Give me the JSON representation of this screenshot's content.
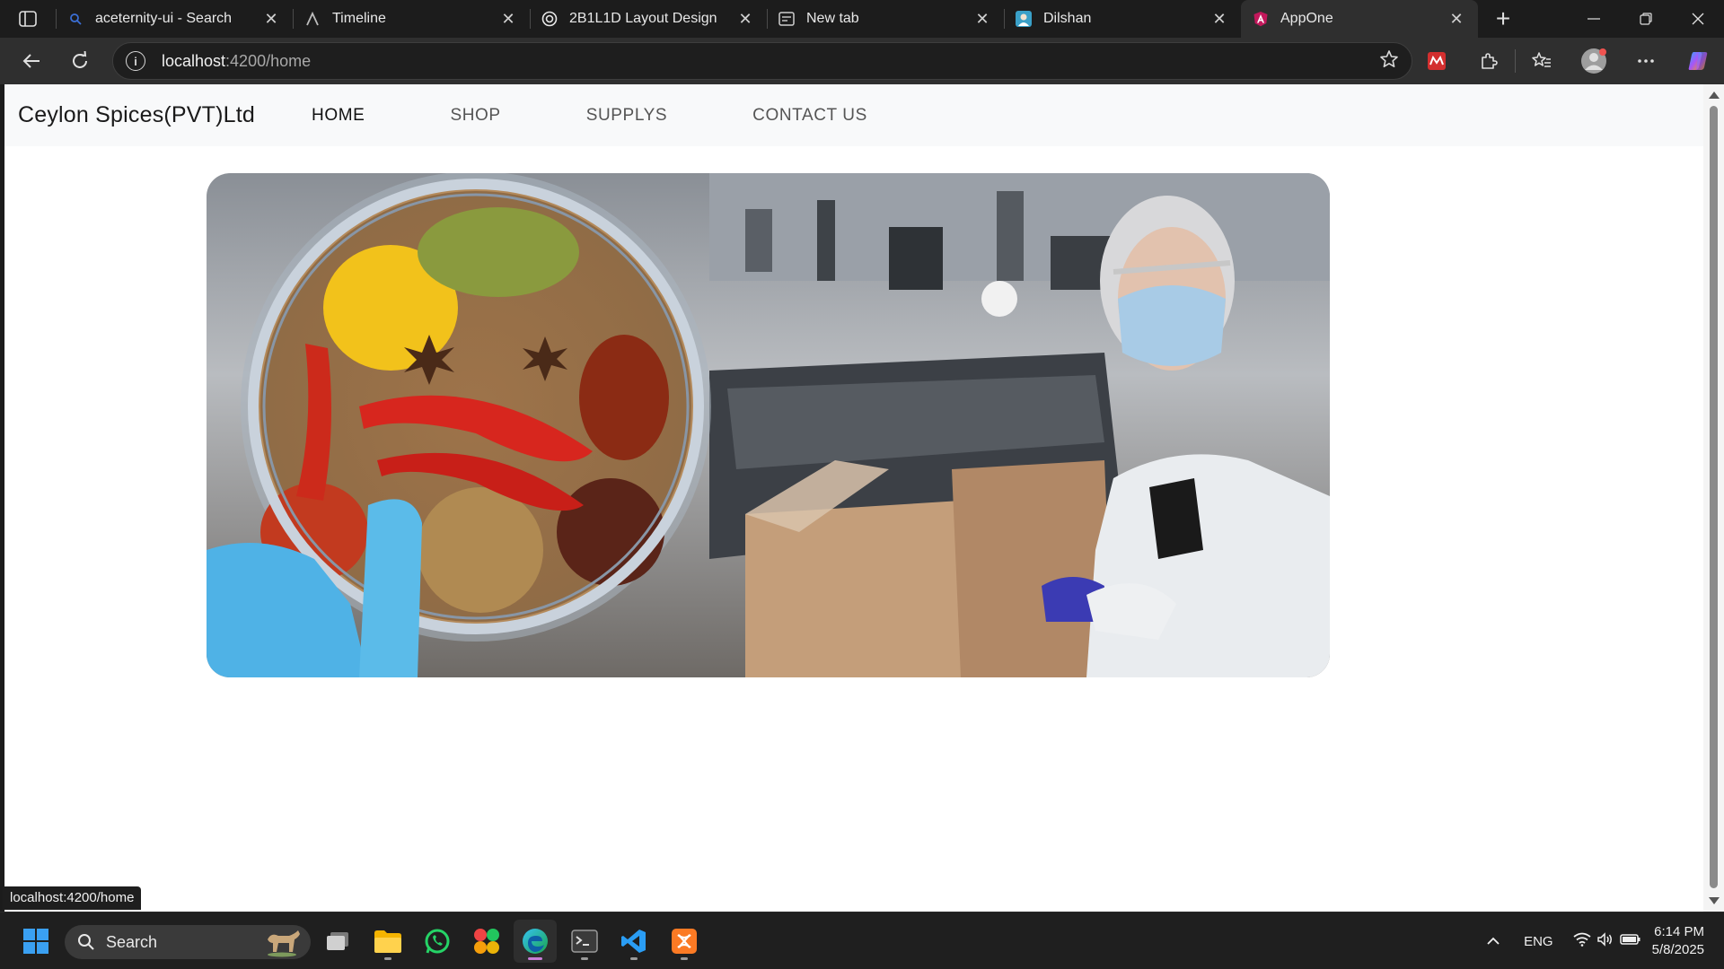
{
  "tabs": [
    {
      "title": "aceternity-ui - Search",
      "icon": "search-favicon",
      "active": false
    },
    {
      "title": "Timeline",
      "icon": "a-logo-favicon",
      "active": false
    },
    {
      "title": "2B1L1D Layout Design",
      "icon": "openai-favicon",
      "active": false
    },
    {
      "title": "New tab",
      "icon": "newtab-favicon",
      "active": false
    },
    {
      "title": "Dilshan",
      "icon": "profile-favicon",
      "active": false
    },
    {
      "title": "AppOne",
      "icon": "angular-favicon",
      "active": true
    }
  ],
  "address": {
    "host": "localhost",
    "path": ":4200/home"
  },
  "app": {
    "brand": "Ceylon Spices(PVT)Ltd",
    "nav": [
      {
        "label": "HOME",
        "active": true
      },
      {
        "label": "SHOP",
        "active": false
      },
      {
        "label": "SUPPLYS",
        "active": false
      },
      {
        "label": "CONTACT US",
        "active": false
      }
    ],
    "hero_image": "spices-and-factory-worker-banner"
  },
  "status_url": "localhost:4200/home",
  "taskbar": {
    "search_label": "Search",
    "language": "ENG",
    "time": "6:14 PM",
    "date": "5/8/2025"
  },
  "colors": {
    "accent": "#c77dd7",
    "chrome": "#2f2f2f",
    "taskbar": "#1f1f1f"
  }
}
